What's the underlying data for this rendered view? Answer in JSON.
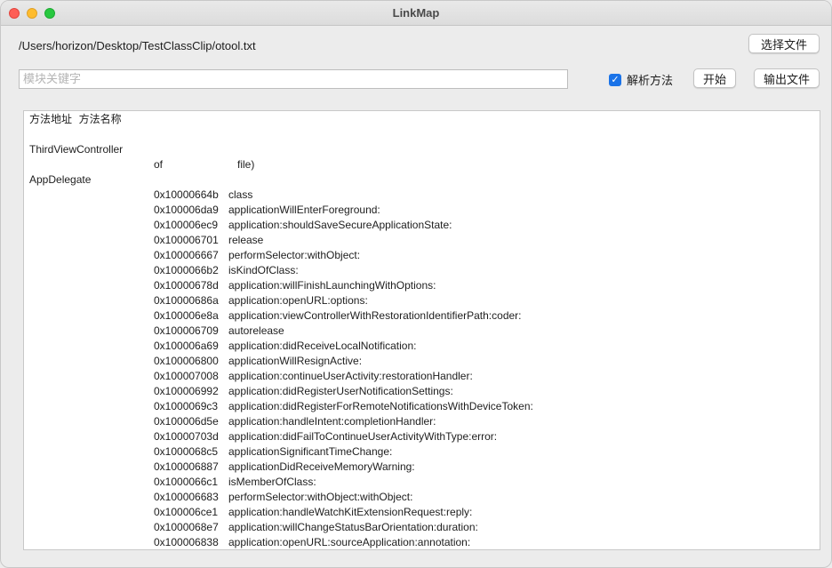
{
  "window": {
    "title": "LinkMap"
  },
  "file_path": "/Users/horizon/Desktop/TestClassClip/otool.txt",
  "buttons": {
    "select_file": "选择文件",
    "start": "开始",
    "output_file": "输出文件"
  },
  "search": {
    "placeholder": "模块关键字",
    "value": ""
  },
  "parse_methods": {
    "label": "解析方法",
    "checked": true
  },
  "colors": {
    "checkbox_accent": "#1a73e8",
    "close": "#fe5f57",
    "minimize": "#febc2e",
    "maximize": "#28c840"
  },
  "output": {
    "header": "方法地址  方法名称",
    "groups": [
      {
        "name": "ThirdViewController",
        "rows": [
          {
            "addr": "of",
            "method": "   file)"
          }
        ]
      },
      {
        "name": "AppDelegate",
        "rows": [
          {
            "addr": "0x10000664b",
            "method": "class"
          },
          {
            "addr": "0x100006da9",
            "method": "applicationWillEnterForeground:"
          },
          {
            "addr": "0x100006ec9",
            "method": "application:shouldSaveSecureApplicationState:"
          },
          {
            "addr": "0x100006701",
            "method": "release"
          },
          {
            "addr": "0x100006667",
            "method": "performSelector:withObject:"
          },
          {
            "addr": "0x1000066b2",
            "method": "isKindOfClass:"
          },
          {
            "addr": "0x10000678d",
            "method": "application:willFinishLaunchingWithOptions:"
          },
          {
            "addr": "0x10000686a",
            "method": "application:openURL:options:"
          },
          {
            "addr": "0x100006e8a",
            "method": "application:viewControllerWithRestorationIdentifierPath:coder:"
          },
          {
            "addr": "0x100006709",
            "method": "autorelease"
          },
          {
            "addr": "0x100006a69",
            "method": "application:didReceiveLocalNotification:"
          },
          {
            "addr": "0x100006800",
            "method": "applicationWillResignActive:"
          },
          {
            "addr": "0x100007008",
            "method": "application:continueUserActivity:restorationHandler:"
          },
          {
            "addr": "0x100006992",
            "method": "application:didRegisterUserNotificationSettings:"
          },
          {
            "addr": "0x1000069c3",
            "method": "application:didRegisterForRemoteNotificationsWithDeviceToken:"
          },
          {
            "addr": "0x100006d5e",
            "method": "application:handleIntent:completionHandler:"
          },
          {
            "addr": "0x10000703d",
            "method": "application:didFailToContinueUserActivityWithType:error:"
          },
          {
            "addr": "0x1000068c5",
            "method": "applicationSignificantTimeChange:"
          },
          {
            "addr": "0x100006887",
            "method": "applicationDidReceiveMemoryWarning:"
          },
          {
            "addr": "0x1000066c1",
            "method": "isMemberOfClass:"
          },
          {
            "addr": "0x100006683",
            "method": "performSelector:withObject:withObject:"
          },
          {
            "addr": "0x100006ce1",
            "method": "application:handleWatchKitExtensionRequest:reply:"
          },
          {
            "addr": "0x1000068e7",
            "method": "application:willChangeStatusBarOrientation:duration:"
          },
          {
            "addr": "0x100006838",
            "method": "application:openURL:sourceApplication:annotation:"
          }
        ]
      }
    ]
  }
}
